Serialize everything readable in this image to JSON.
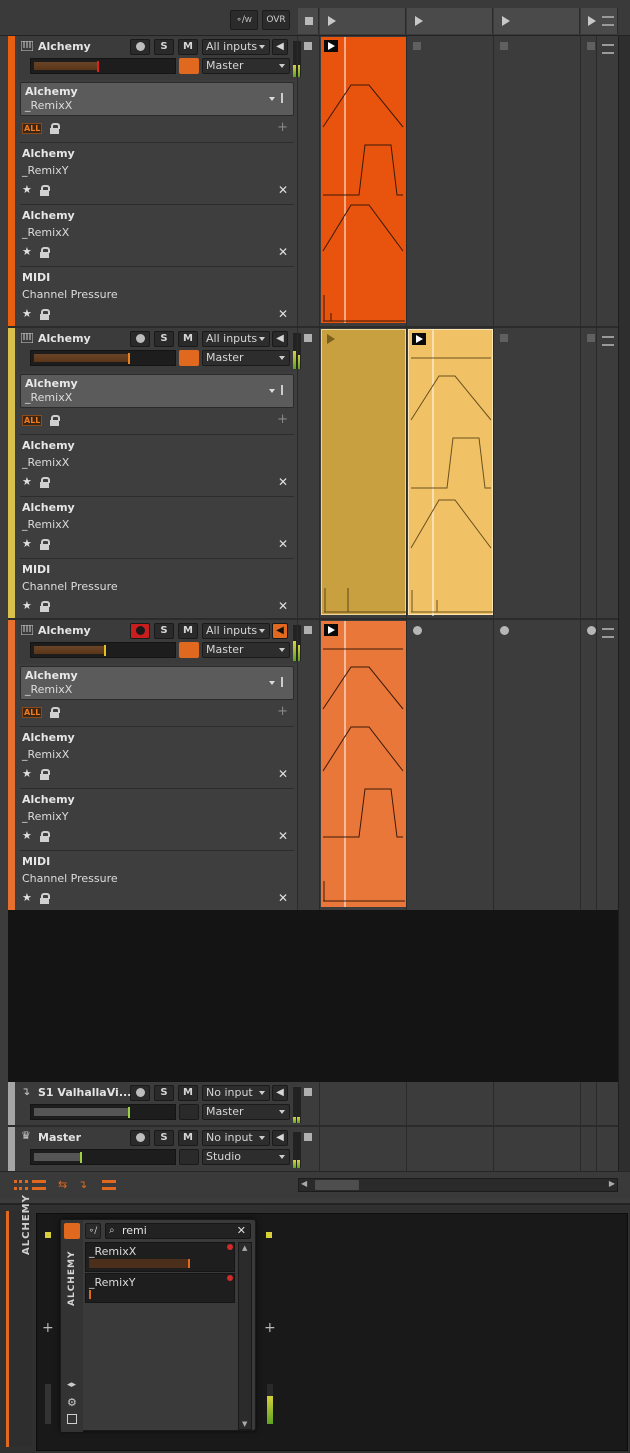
{
  "toolbar": {
    "overdub_label": "OVR",
    "write_label": "W"
  },
  "tracks": [
    {
      "name": "Alchemy",
      "color": "#e8600f",
      "input": "All inputs",
      "output": "Master",
      "record_armed": false,
      "device": {
        "line1": "Alchemy",
        "line2": "_RemixX"
      },
      "all_badge": "ALL",
      "modulators": [
        {
          "line1": "Alchemy",
          "line2": "_RemixY"
        },
        {
          "line1": "Alchemy",
          "line2": "_RemixX"
        },
        {
          "line1": "MIDI",
          "line2": "Channel Pressure"
        }
      ]
    },
    {
      "name": "Alchemy",
      "color": "#d8c04a",
      "input": "All inputs",
      "output": "Master",
      "record_armed": false,
      "device": {
        "line1": "Alchemy",
        "line2": "_RemixX"
      },
      "all_badge": "ALL",
      "modulators": [
        {
          "line1": "Alchemy",
          "line2": "_RemixX"
        },
        {
          "line1": "Alchemy",
          "line2": "_RemixX"
        },
        {
          "line1": "MIDI",
          "line2": "Channel Pressure"
        }
      ]
    },
    {
      "name": "Alchemy",
      "color": "#e8702f",
      "input": "All inputs",
      "output": "Master",
      "record_armed": true,
      "device": {
        "line1": "Alchemy",
        "line2": "_RemixX"
      },
      "all_badge": "ALL",
      "modulators": [
        {
          "line1": "Alchemy",
          "line2": "_RemixX"
        },
        {
          "line1": "Alchemy",
          "line2": "_RemixY"
        },
        {
          "line1": "MIDI",
          "line2": "Channel Pressure"
        }
      ]
    }
  ],
  "effect_track": {
    "name": "S1 ValhallaVi...",
    "input": "No input",
    "output": "Master"
  },
  "master_track": {
    "name": "Master",
    "input": "No input",
    "output": "Studio"
  },
  "buttons": {
    "solo": "S",
    "mute": "M"
  },
  "device_panel": {
    "label": "ALCHEMY",
    "popup_label": "ALCHEMY",
    "search_value": "remi",
    "presets": [
      {
        "name": "_RemixX",
        "level": 0.65
      },
      {
        "name": "_RemixY",
        "level": 0.0
      }
    ]
  },
  "colors": {
    "clip_track1": "#e8530d",
    "clip_track2_a": "#c9a040",
    "clip_track2_b": "#f0c265",
    "clip_track3": "#e9773a",
    "accent": "#e0691f",
    "meter_yellow": "#d7d03b"
  }
}
